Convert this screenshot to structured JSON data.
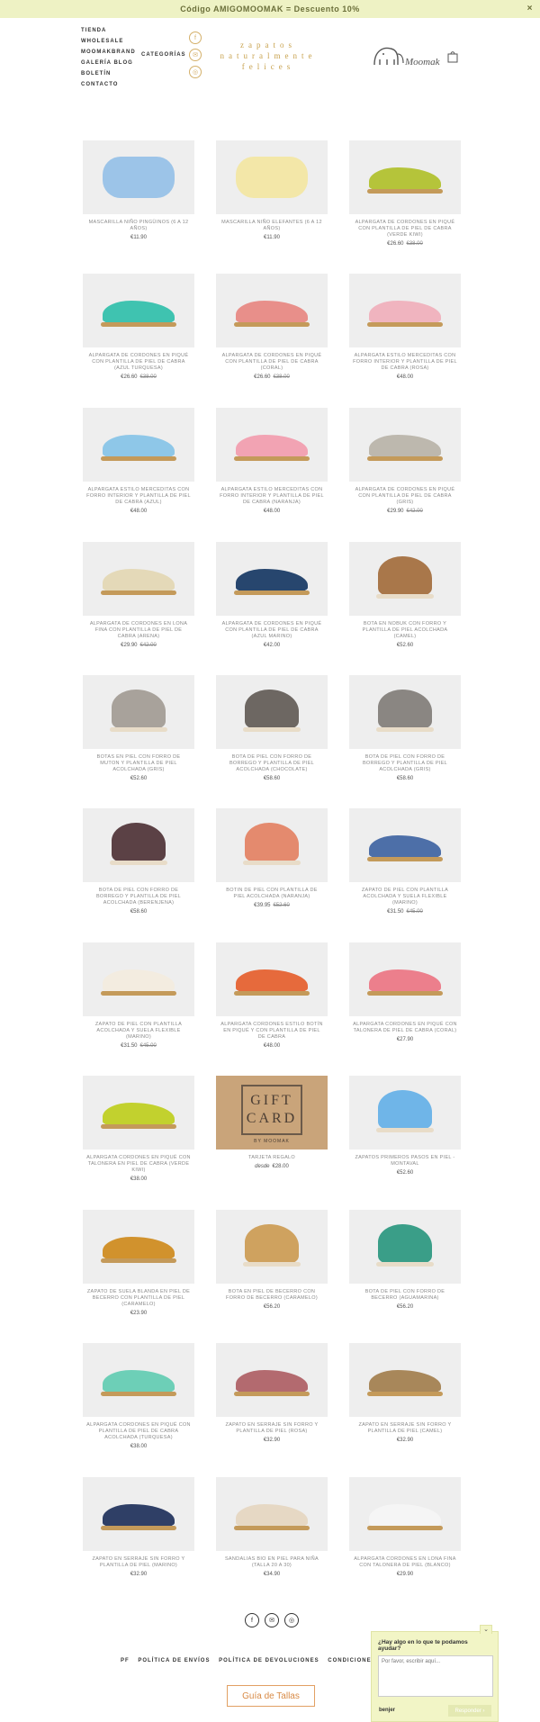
{
  "promo": {
    "text": "Código AMIGOMOOMAK = Descuento 10%",
    "close": "×"
  },
  "nav": {
    "items": [
      "TIENDA",
      "WHOLESALE",
      "MOOMAKBRAND",
      "GALERÍA   BLOG",
      "BOLETÍN",
      "CONTACTO"
    ],
    "categories": "CATEGORÍAS"
  },
  "tagline": {
    "line1": "zapatos",
    "line2": "naturalmente",
    "line3": "felices"
  },
  "logo": {
    "text": "Moomak"
  },
  "colors": {
    "accent": "#c8a24e",
    "promo_bg": "#eef2c4",
    "chat_bg": "#f2f5c6"
  },
  "products": [
    {
      "name": "MASCARILLA NIÑO PINGÜINOS (6 A 12 AÑOS)",
      "price": "€11.90",
      "old": "",
      "kind": "mask",
      "color": "#9cc4e8"
    },
    {
      "name": "MASCARILLA NIÑO ELEFANTES (6 A 12 AÑOS)",
      "price": "€11.90",
      "old": "",
      "kind": "mask",
      "color": "#f3e7a8"
    },
    {
      "name": "ALPARGATA DE CORDONES EN PIQUÉ CON PLANTILLA DE PIEL DE CABRA (VERDE KIWI)",
      "price": "€26.60",
      "old": "€38.00",
      "kind": "shoe",
      "color": "#b5c43a"
    },
    {
      "name": "ALPARGATA DE CORDONES EN PIQUÉ CON PLANTILLA DE PIEL DE CABRA (AZUL TURQUESA)",
      "price": "€26.60",
      "old": "€38.00",
      "kind": "shoe",
      "color": "#3fc3b0"
    },
    {
      "name": "ALPARGATA DE CORDONES EN PIQUÉ CON PLANTILLA DE PIEL DE CABRA (CORAL)",
      "price": "€26.60",
      "old": "€38.00",
      "kind": "shoe",
      "color": "#e88f8a"
    },
    {
      "name": "ALPARGATA ESTILO MERCEDITAS CON FORRO INTERIOR Y PLANTILLA DE PIEL DE CABRA (ROSA)",
      "price": "€48.00",
      "old": "",
      "kind": "shoe",
      "color": "#f0b4bf"
    },
    {
      "name": "ALPARGATA ESTILO MERCEDITAS CON FORRO INTERIOR Y PLANTILLA DE PIEL DE CABRA (AZUL)",
      "price": "€48.00",
      "old": "",
      "kind": "shoe",
      "color": "#8ec7e8"
    },
    {
      "name": "ALPARGATA ESTILO MERCEDITAS CON FORRO INTERIOR Y PLANTILLA DE PIEL DE CABRA (NARANJA)",
      "price": "€48.00",
      "old": "",
      "kind": "shoe",
      "color": "#f2a3b3"
    },
    {
      "name": "ALPARGATA DE CORDONES EN PIQUÉ CON PLANTILLA DE PIEL DE CABRA (GRIS)",
      "price": "€29.90",
      "old": "€42.00",
      "kind": "shoe",
      "color": "#bdb8ae"
    },
    {
      "name": "ALPARGATA DE CORDONES EN LONA FINA CON PLANTILLA DE PIEL DE CABRA (ARENA)",
      "price": "€29.90",
      "old": "€42.00",
      "kind": "shoe",
      "color": "#e4d9b8"
    },
    {
      "name": "ALPARGATA DE CORDONES EN PIQUÉ CON PLANTILLA DE PIEL DE CABRA (AZUL MARINO)",
      "price": "€42.00",
      "old": "",
      "kind": "shoe",
      "color": "#27466e"
    },
    {
      "name": "BOTA EN NOBUK CON FORRO Y PLANTILLA DE PIEL ACOLCHADA (CAMEL)",
      "price": "€52.60",
      "old": "",
      "kind": "boot",
      "color": "#a9774a"
    },
    {
      "name": "BOTAS EN PIEL CON FORRO DE MUTON Y PLANTILLA DE PIEL ACOLCHADA (GRIS)",
      "price": "€52.60",
      "old": "",
      "kind": "boot",
      "color": "#a8a29b"
    },
    {
      "name": "BOTA DE PIEL CON FORRO DE BORREGO Y PLANTILLA DE PIEL ACOLCHADA (CHOCOLATE)",
      "price": "€58.60",
      "old": "",
      "kind": "boot",
      "color": "#6d6762"
    },
    {
      "name": "BOTA DE PIEL CON FORRO DE BORREGO Y PLANTILLA DE PIEL ACOLCHADA (GRIS)",
      "price": "€58.60",
      "old": "",
      "kind": "boot",
      "color": "#8a8682"
    },
    {
      "name": "BOTA DE PIEL CON FORRO DE BORREGO Y PLANTILLA DE PIEL ACOLCHADA (BERENJENA)",
      "price": "€58.60",
      "old": "",
      "kind": "boot",
      "color": "#5b4145"
    },
    {
      "name": "BOTIN DE PIEL CON PLANTILLA DE PIEL ACOLCHADA (NARANJA)",
      "price": "€39.95",
      "old": "€52.60",
      "kind": "boot",
      "color": "#e48a6e"
    },
    {
      "name": "ZAPATO DE PIEL CON PLANTILLA ACOLCHADA Y SUELA FLEXIBLE (MARINO)",
      "price": "€31.50",
      "old": "€45.00",
      "kind": "shoe",
      "color": "#4d6fa8"
    },
    {
      "name": "ZAPATO DE PIEL CON PLANTILLA ACOLCHADA Y SUELA FLEXIBLE (MARINO)",
      "price": "€31.50",
      "old": "€45.00",
      "kind": "shoe",
      "color": "#f3ece0"
    },
    {
      "name": "ALPARGATA CORDONES ESTILO BOTÍN EN PIQUÉ Y CON PLANTILLA DE PIEL DE CABRA",
      "price": "€48.00",
      "old": "",
      "kind": "shoe",
      "color": "#e66a3c"
    },
    {
      "name": "ALPARGATA CORDONES EN PIQUÉ CON TALONERA DE PIEL DE CABRA (CORAL)",
      "price": "€27.90",
      "old": "",
      "kind": "shoe",
      "color": "#ec7f8c"
    },
    {
      "name": "ALPARGATA CORDONES EN PIQUÉ CON TALONERA EN PIEL DE CABRA (VERDE KIWI)",
      "price": "€38.00",
      "old": "",
      "kind": "shoe",
      "color": "#c2d12e"
    },
    {
      "name": "TARJETA REGALO",
      "price": "€28.00",
      "prefix": "desde",
      "old": "",
      "kind": "gift",
      "color": "#c9a47a"
    },
    {
      "name": "ZAPATOS PRIMEROS PASOS EN PIEL - MONTAVAL",
      "price": "€52.60",
      "old": "",
      "kind": "boot",
      "color": "#6fb5e8"
    },
    {
      "name": "ZAPATO DE SUELA BLANDA EN PIEL DE BECERRO CON PLANTILLA DE PIEL (CARAMELO)",
      "price": "€23.90",
      "old": "",
      "kind": "shoe",
      "color": "#d1922d"
    },
    {
      "name": "BOTA EN PIEL DE BECERRO CON FORRO DE BECERRO (CARAMELO)",
      "price": "€56.20",
      "old": "",
      "kind": "boot",
      "color": "#cfa25f"
    },
    {
      "name": "BOTA DE PIEL CON FORRO DE BECERRO (AGUAMARINA)",
      "price": "€56.20",
      "old": "",
      "kind": "boot",
      "color": "#3a9e88"
    },
    {
      "name": "ALPARGATA CORDONES EN PIQUÉ CON PLANTILLA DE PIEL DE CABRA ACOLCHADA (TURQUESA)",
      "price": "€38.00",
      "old": "",
      "kind": "shoe",
      "color": "#6dcfb7"
    },
    {
      "name": "ZAPATO EN SERRAJE SIN FORRO Y PLANTILLA DE PIEL (ROSA)",
      "price": "€32.90",
      "old": "",
      "kind": "shoe",
      "color": "#b36a6f"
    },
    {
      "name": "ZAPATO EN SERRAJE SIN FORRO Y PLANTILLA DE PIEL (CAMEL)",
      "price": "€32.90",
      "old": "",
      "kind": "shoe",
      "color": "#a8875a"
    },
    {
      "name": "ZAPATO EN SERRAJE SIN FORRO Y PLANTILLA DE PIEL (MARINO)",
      "price": "€32.90",
      "old": "",
      "kind": "shoe",
      "color": "#2f3f66"
    },
    {
      "name": "SANDALIAS BIO EN PIEL PARA NIÑA (TALLA 20 A 30)",
      "price": "€34.90",
      "old": "",
      "kind": "shoe",
      "color": "#e6d8c4"
    },
    {
      "name": "ALPARGATA CORDONES EN LONA FINA CON TALONERA DE PIEL (BLANCO)",
      "price": "€29.90",
      "old": "",
      "kind": "shoe",
      "color": "#f5f5f5"
    }
  ],
  "gift_card": {
    "line1": "GIFT",
    "line2": "CARD",
    "by": "BY MOOMAK"
  },
  "footer": {
    "links": [
      "PF",
      "POLÍTICA DE ENVÍOS",
      "POLÍTICA DE DEVOLUCIONES",
      "CONDICIONES DE US"
    ],
    "guide": "Guía de Tallas"
  },
  "chat": {
    "title": "¿Hay algo en lo que te podamos ayudar?",
    "placeholder": "Por favor, escribir aquí...",
    "brand": "benjer",
    "send": "Responder ›"
  }
}
